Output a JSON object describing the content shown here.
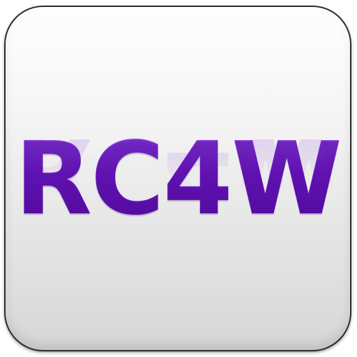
{
  "icon": {
    "logo_text": "RC4W",
    "colors": {
      "logo": "#6a17c4",
      "background_top": "#fbfbfb",
      "background_bottom": "#d6d6d6",
      "border": "#2a2a2a"
    }
  }
}
